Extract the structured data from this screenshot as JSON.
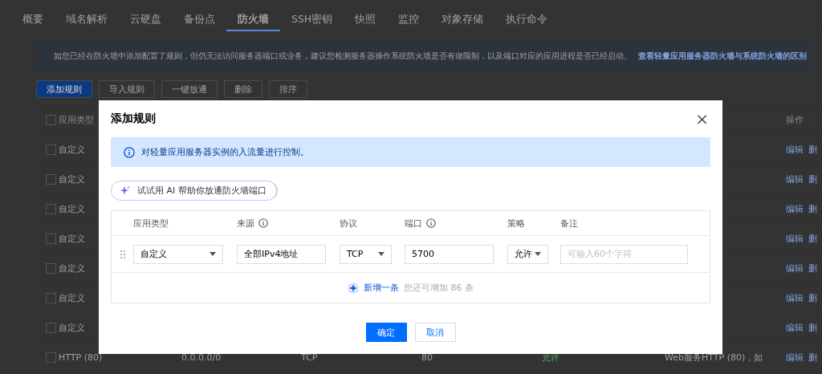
{
  "nav_tabs": [
    {
      "label": "概要",
      "selected": false
    },
    {
      "label": "域名解析",
      "selected": false
    },
    {
      "label": "云硬盘",
      "selected": false
    },
    {
      "label": "备份点",
      "selected": false
    },
    {
      "label": "防火墙",
      "selected": true
    },
    {
      "label": "SSH密钥",
      "selected": false
    },
    {
      "label": "快照",
      "selected": false
    },
    {
      "label": "监控",
      "selected": false
    },
    {
      "label": "对象存储",
      "selected": false
    },
    {
      "label": "执行命令",
      "selected": false
    }
  ],
  "notice": {
    "text": "如您已经在防火墙中添加配置了规则，但仍无法访问服务器端口或业务，建议您检测服务器操作系统防火墙是否有做限制，以及端口对应的应用进程是否已经启动。",
    "link": "查看轻量应用服务器防火墙与系统防火墙的区别"
  },
  "toolbar": [
    {
      "label": "添加规则",
      "kind": "primary"
    },
    {
      "label": "导入规则",
      "kind": "default"
    },
    {
      "label": "一键放通",
      "kind": "default"
    },
    {
      "label": "删除",
      "kind": "default"
    },
    {
      "label": "排序",
      "kind": "default"
    }
  ],
  "rules_table": {
    "columns": {
      "type": "应用类型",
      "actions": "操作"
    },
    "all_checked": false,
    "rows": [
      {
        "checked": false,
        "type": "自定义",
        "actions": [
          "编辑",
          "删"
        ]
      },
      {
        "checked": false,
        "type": "自定义",
        "actions": [
          "编辑",
          "删"
        ]
      },
      {
        "checked": false,
        "type": "自定义",
        "actions": [
          "编辑",
          "删"
        ]
      },
      {
        "checked": false,
        "type": "自定义",
        "actions": [
          "编辑",
          "删"
        ]
      },
      {
        "checked": false,
        "type": "自定义",
        "actions": [
          "编辑",
          "删"
        ]
      },
      {
        "checked": false,
        "type": "自定义",
        "actions": [
          "编辑",
          "删"
        ]
      },
      {
        "checked": false,
        "type": "自定义",
        "actions": [
          "编辑",
          "删"
        ]
      },
      {
        "checked": false,
        "type": "HTTP (80)",
        "source": "0.0.0.0/0",
        "protocol": "TCP",
        "port": "80",
        "policy": "允许",
        "note": "Web服务HTTP (80)，如",
        "actions": [
          "编辑",
          "删"
        ]
      }
    ]
  },
  "dialog": {
    "title": "添加规则",
    "close": "×",
    "info": "对轻量应用服务器实例的入流量进行控制。",
    "ai_button": "试试用 AI 帮助你放通防火墙端口",
    "columns": [
      {
        "label": "应用类型",
        "info": false
      },
      {
        "label": "来源",
        "info": true
      },
      {
        "label": "协议",
        "info": false
      },
      {
        "label": "端口",
        "info": true
      },
      {
        "label": "策略",
        "info": false
      },
      {
        "label": "备注",
        "info": false
      }
    ],
    "fields": [
      {
        "kind": "select",
        "value": "自定义"
      },
      {
        "kind": "input",
        "value": "全部IPv4地址"
      },
      {
        "kind": "select",
        "value": "TCP"
      },
      {
        "kind": "input",
        "value": "5700"
      },
      {
        "kind": "select",
        "value": "允许"
      },
      {
        "kind": "input",
        "placeholder": "可输入60个字符"
      }
    ],
    "add_link": "新增一条",
    "add_hint": "您还可增加 86 条",
    "buttons": [
      {
        "label": "确定",
        "kind": "primary"
      },
      {
        "label": "取消",
        "kind": "default"
      }
    ]
  }
}
